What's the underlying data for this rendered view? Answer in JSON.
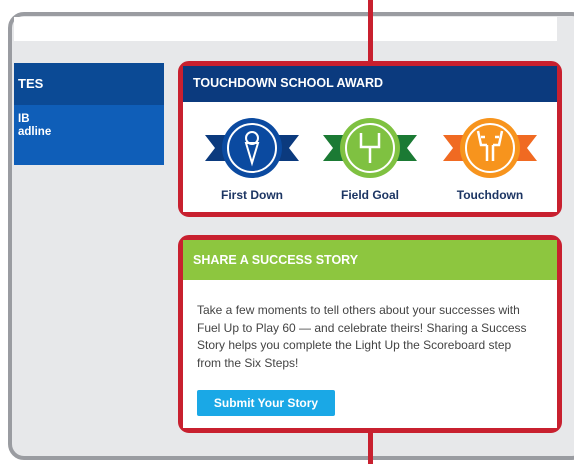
{
  "left_panel": {
    "heading": "TES",
    "line1": "IB",
    "line2": "adline"
  },
  "award": {
    "title": "TOUCHDOWN SCHOOL AWARD",
    "header_color": "#0b3a7e",
    "items": [
      {
        "label": "First Down",
        "icon": "ice-cream-icon",
        "color": "#0b4aa0"
      },
      {
        "label": "Field Goal",
        "icon": "goalpost-icon",
        "color": "#7fc141"
      },
      {
        "label": "Touchdown",
        "icon": "raised-hands-icon",
        "color": "#f7941d"
      }
    ]
  },
  "story": {
    "title": "SHARE A SUCCESS STORY",
    "header_color": "#8dc63f",
    "body": "Take a few moments to tell others about your successes with Fuel Up to Play 60 — and celebrate theirs! Sharing a Success Story helps you complete the Light Up the Scoreboard step from the Six Steps!",
    "button_label": "Submit Your Story"
  },
  "colors": {
    "callout": "#c8202f",
    "button": "#1aa8e6"
  }
}
